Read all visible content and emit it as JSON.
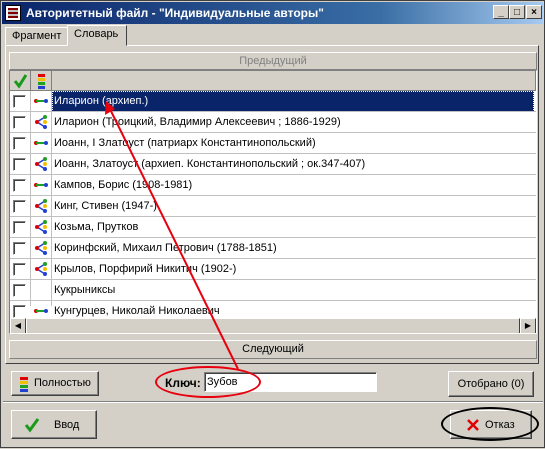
{
  "window": {
    "title": "Авторитетный файл - \"Индивидуальные авторы\"",
    "controls": {
      "minimize": "_",
      "maximize": "□",
      "close": "×"
    }
  },
  "tabs": [
    {
      "label": "Фрагмент",
      "active": false
    },
    {
      "label": "Словарь",
      "active": true
    }
  ],
  "nav": {
    "previous": "Предыдущий",
    "next": "Следующий"
  },
  "grid": {
    "header_icons": [
      "check-icon",
      "stack-icon"
    ],
    "rows": [
      {
        "name": "Иларион (архиеп.)",
        "icon": "link-icon",
        "selected": true
      },
      {
        "name": "Иларион (Троицкий, Владимир Алексеевич ; 1886-1929)",
        "icon": "tree-icon",
        "selected": false
      },
      {
        "name": "Иоанн, I Златоуст (патриарх Константинопольский)",
        "icon": "link-icon",
        "selected": false
      },
      {
        "name": "Иоанн, Златоуст (архиеп. Константинопольский ; ок.347-407)",
        "icon": "tree-icon",
        "selected": false
      },
      {
        "name": "Кампов, Борис (1908-1981)",
        "icon": "link-icon",
        "selected": false
      },
      {
        "name": "Кинг, Стивен (1947-)",
        "icon": "tree-icon",
        "selected": false
      },
      {
        "name": "Козьма, Прутков",
        "icon": "tree-icon",
        "selected": false
      },
      {
        "name": "Коринфский, Михаил Петрович (1788-1851)",
        "icon": "tree-icon",
        "selected": false
      },
      {
        "name": "Крылов, Порфирий Никитич (1902-)",
        "icon": "tree-icon",
        "selected": false
      },
      {
        "name": "Кукрыниксы",
        "icon": "",
        "selected": false
      },
      {
        "name": "Кунгурцев, Николай Николаевич",
        "icon": "link-icon",
        "selected": false
      }
    ]
  },
  "bottom": {
    "full_button": "Полностью",
    "key_label": "Ключ:",
    "key_value": "Зубов",
    "selected_button": "Отобрано (0)",
    "enter_button": "Ввод",
    "cancel_button": "Отказ"
  },
  "colors": {
    "accent_annotation": "#e8000e",
    "selection": "#0a246a"
  }
}
